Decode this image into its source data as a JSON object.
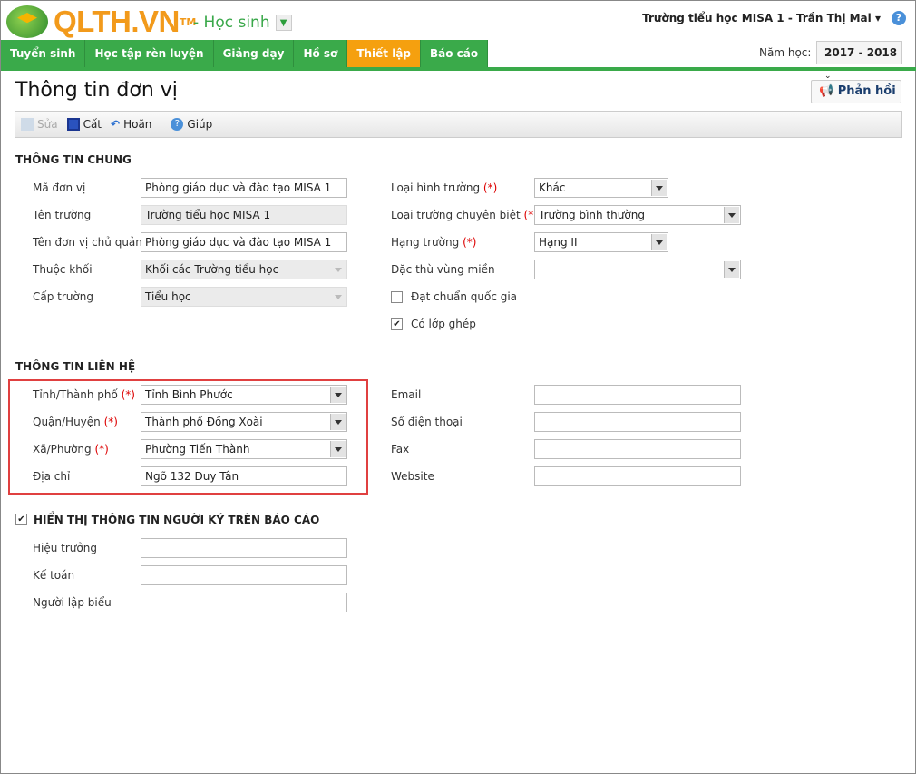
{
  "header": {
    "logo": "QLTH.VN",
    "tm": "TM",
    "role": "- Học sinh",
    "user": "Trường tiểu học MISA 1 - Trần Thị Mai",
    "year_label": "Năm học:",
    "year": "2017 - 2018"
  },
  "nav": [
    "Tuyển sinh",
    "Học tập rèn luyện",
    "Giảng dạy",
    "Hồ sơ",
    "Thiết lập",
    "Báo cáo"
  ],
  "page": {
    "title": "Thông tin đơn vị",
    "feedback": "Phản hồi"
  },
  "toolbar": {
    "edit": "Sửa",
    "save": "Cất",
    "undo": "Hoãn",
    "help": "Giúp"
  },
  "general": {
    "title": "THÔNG TIN CHUNG",
    "left": [
      {
        "label": "Mã đơn vị",
        "value": "Phòng giáo dục và đào tạo MISA 1"
      },
      {
        "label": "Tên trường",
        "value": "Trường tiểu học MISA 1"
      },
      {
        "label": "Tên đơn vị chủ quản",
        "value": "Phòng giáo dục và đào tạo MISA 1"
      },
      {
        "label": "Thuộc khối",
        "value": "Khối các Trường tiểu học"
      },
      {
        "label": "Cấp trường",
        "value": "Tiểu học"
      }
    ],
    "right": [
      {
        "label": "Loại hình trường",
        "req": "(*)",
        "value": "Khác"
      },
      {
        "label": "Loại trường chuyên biệt",
        "req": "(*)",
        "value": "Trường bình thường"
      },
      {
        "label": "Hạng trường",
        "req": "(*)",
        "value": "Hạng II"
      },
      {
        "label": "Đặc thù vùng miền",
        "value": ""
      }
    ],
    "checks": [
      {
        "label": "Đạt chuẩn quốc gia",
        "checked": false
      },
      {
        "label": "Có lớp ghép",
        "checked": true
      }
    ]
  },
  "contact": {
    "title": "THÔNG TIN LIÊN HỆ",
    "req": "(*)",
    "left": [
      {
        "label": "Tỉnh/Thành phố",
        "value": "Tỉnh Bình Phước"
      },
      {
        "label": "Quận/Huyện",
        "value": "Thành phố Đồng Xoài"
      },
      {
        "label": "Xã/Phường",
        "value": "Phường Tiến Thành"
      },
      {
        "label": "Địa chỉ",
        "value": "Ngõ 132 Duy Tân"
      }
    ],
    "right": [
      {
        "label": "Email",
        "value": ""
      },
      {
        "label": "Số điện thoại",
        "value": ""
      },
      {
        "label": "Fax",
        "value": ""
      },
      {
        "label": "Website",
        "value": ""
      }
    ]
  },
  "signer": {
    "title": "HIỂN THỊ THÔNG TIN NGƯỜI KÝ TRÊN BÁO CÁO",
    "checked": true,
    "fields": [
      {
        "label": "Hiệu trưởng",
        "value": ""
      },
      {
        "label": "Kế toán",
        "value": ""
      },
      {
        "label": "Người lập biểu",
        "value": ""
      }
    ]
  }
}
